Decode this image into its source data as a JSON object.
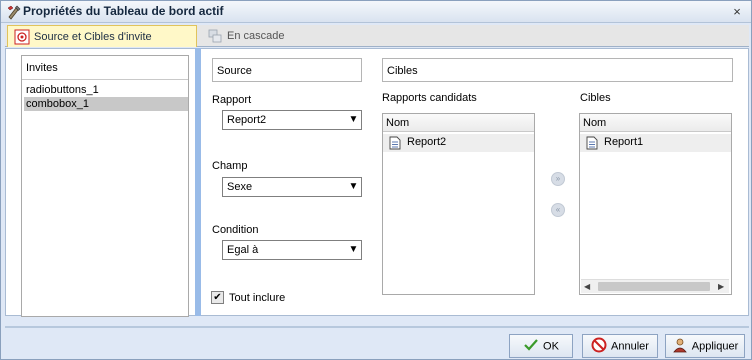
{
  "window": {
    "title": "Propriétés du Tableau de bord actif",
    "close_label": "×"
  },
  "tabs": [
    {
      "label": "Source et Cibles d'invite"
    },
    {
      "label": "En cascade"
    }
  ],
  "invites": {
    "header": "Invites",
    "items": [
      "radiobuttons_1",
      "combobox_1"
    ],
    "selected": "combobox_1"
  },
  "source": {
    "header": "Source"
  },
  "cibles": {
    "header": "Cibles"
  },
  "rapport": {
    "label": "Rapport",
    "value": "Report2"
  },
  "champ": {
    "label": "Champ",
    "value": "Sexe"
  },
  "condition": {
    "label": "Condition",
    "value": "Egal à"
  },
  "tout_inclure": {
    "label": "Tout inclure",
    "checked": true,
    "mark": "✔"
  },
  "candidates": {
    "title": "Rapports candidats",
    "column": "Nom",
    "rows": [
      "Report2"
    ]
  },
  "targets": {
    "title": "Cibles",
    "column": "Nom",
    "rows": [
      "Report1"
    ]
  },
  "move": {
    "add": "»",
    "remove": "«"
  },
  "scroll": {
    "left": "◀",
    "right": "▶"
  },
  "buttons": {
    "ok": "OK",
    "cancel": "Annuler",
    "apply": "Appliquer"
  },
  "dropdown_arrow": "▼",
  "icons": [
    "wrench-pencil-icon",
    "target-icon",
    "cascade-icon",
    "document-icon",
    "checkmark-icon",
    "cancel-icon",
    "apply-person-icon"
  ],
  "colors": {
    "accent_strip": "#99bbe8",
    "active_tab": "#fff8c8",
    "ok_check": "#3a9a2a",
    "cancel_red": "#cc2222"
  }
}
